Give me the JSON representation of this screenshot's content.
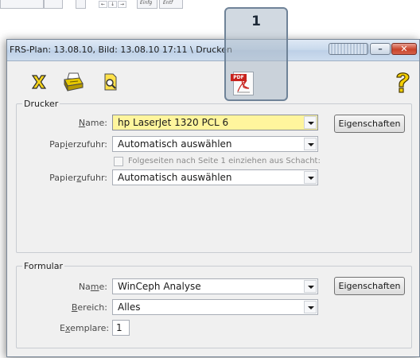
{
  "background": {
    "keys": [
      "←",
      "↓",
      "→"
    ],
    "labels": [
      "Einfg",
      "Entf"
    ]
  },
  "window": {
    "title": "FRS-Plan: 13.08.10,  Bild: 13.08.10  17:11 \\ Drucken",
    "close_glyph": "✕",
    "min_glyph": "–"
  },
  "callout": {
    "number": "1"
  },
  "toolbar": {
    "icons": [
      "close-x-icon",
      "printer-icon",
      "print-preview-icon",
      "pdf-icon",
      "help-icon"
    ],
    "pdf_tag": "PDF"
  },
  "drucker": {
    "title": "Drucker",
    "name_label_u": "N",
    "name_label_rest": "ame:",
    "printer_name": "hp LaserJet 1320 PCL 6",
    "properties": "Eigenschaften",
    "papierzufuhr_label_1_pre": "Pap",
    "papierzufuhr_label_1_u": "i",
    "papierzufuhr_label_1_post": "erzufuhr:",
    "papierzufuhr_1": "Automatisch auswählen",
    "followup_label": "Folgeseiten nach Seite 1 einziehen aus Schacht:",
    "papierzufuhr_label_2_pre": "Papier",
    "papierzufuhr_label_2_u": "z",
    "papierzufuhr_label_2_post": "ufuhr:",
    "papierzufuhr_2": "Automatisch auswählen"
  },
  "formular": {
    "title": "Formular",
    "name_label_pre": "Na",
    "name_label_u": "m",
    "name_label_post": "e:",
    "form_name": "WinCeph Analyse",
    "properties": "Eigenschaften",
    "bereich_label_u": "B",
    "bereich_label_rest": "ereich:",
    "bereich": "Alles",
    "exemplare_label_pre": "E",
    "exemplare_label_u": "x",
    "exemplare_label_post": "emplare:",
    "exemplare": "1"
  }
}
